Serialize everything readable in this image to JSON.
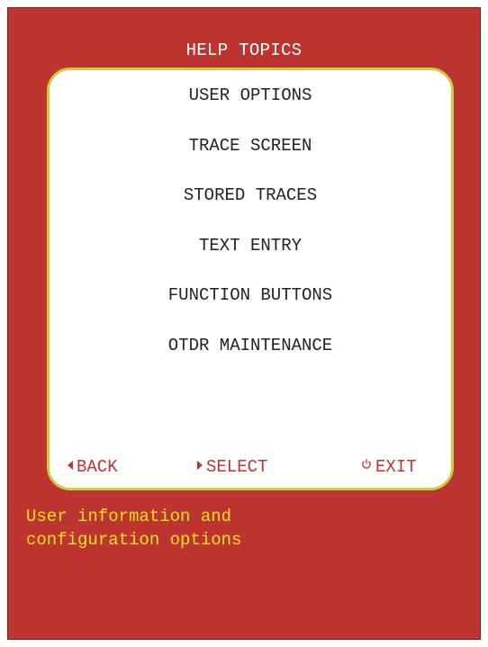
{
  "header": {
    "title": "HELP TOPICS"
  },
  "menu": {
    "items": [
      {
        "label": "USER OPTIONS"
      },
      {
        "label": "TRACE SCREEN"
      },
      {
        "label": "STORED TRACES"
      },
      {
        "label": "TEXT ENTRY"
      },
      {
        "label": "FUNCTION BUTTONS"
      },
      {
        "label": "OTDR MAINTENANCE"
      }
    ]
  },
  "softkeys": {
    "back": {
      "label": "BACK",
      "icon": "triangle-left-icon"
    },
    "select": {
      "label": "SELECT",
      "icon": "triangle-right-icon"
    },
    "exit": {
      "label": "EXIT",
      "icon": "power-icon"
    }
  },
  "description": {
    "line1": "User information and",
    "line2": "configuration options"
  },
  "colors": {
    "background": "#bd3431",
    "panel_border": "#c8cf3f",
    "description_text": "#f2e21c",
    "softkey_text": "#bd3431"
  }
}
